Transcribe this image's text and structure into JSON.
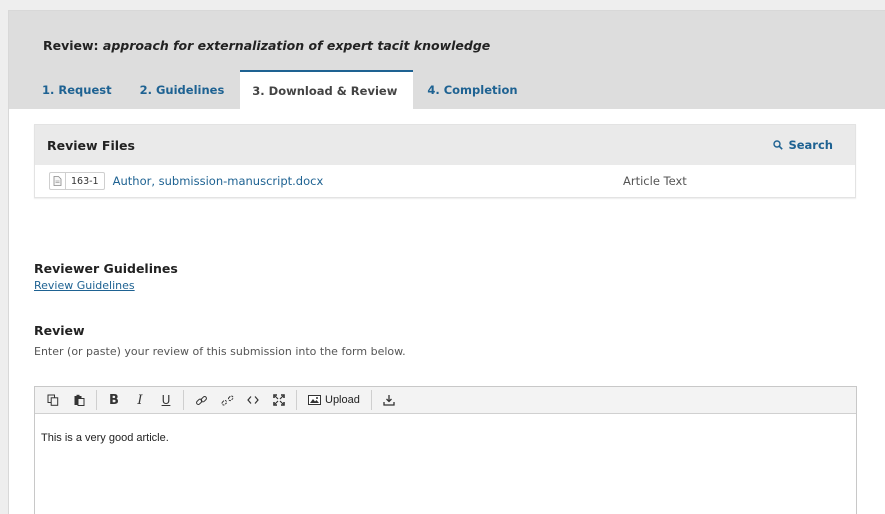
{
  "page": {
    "title_prefix": "Review: ",
    "title_italic": "approach for externalization of expert tacit knowledge"
  },
  "tabs": [
    {
      "label": "1. Request",
      "active": false
    },
    {
      "label": "2. Guidelines",
      "active": false
    },
    {
      "label": "3. Download & Review",
      "active": true
    },
    {
      "label": "4. Completion",
      "active": false
    }
  ],
  "review_files": {
    "heading": "Review Files",
    "search_label": "Search",
    "files": [
      {
        "id": "163-1",
        "name": "Author, submission-manuscript.docx",
        "type": "Article Text",
        "icon": "document-icon"
      }
    ]
  },
  "reviewer_guidelines": {
    "heading": "Reviewer Guidelines",
    "link_label": "Review Guidelines"
  },
  "review": {
    "heading": "Review",
    "description": "Enter (or paste) your review of this submission into the form below.",
    "editor_content": "This is a very good article.",
    "toolbar": {
      "bold": "B",
      "italic": "I",
      "underline": "U",
      "upload_label": "Upload"
    }
  },
  "colors": {
    "link": "#1e6292",
    "header_bg": "#dddddd"
  }
}
